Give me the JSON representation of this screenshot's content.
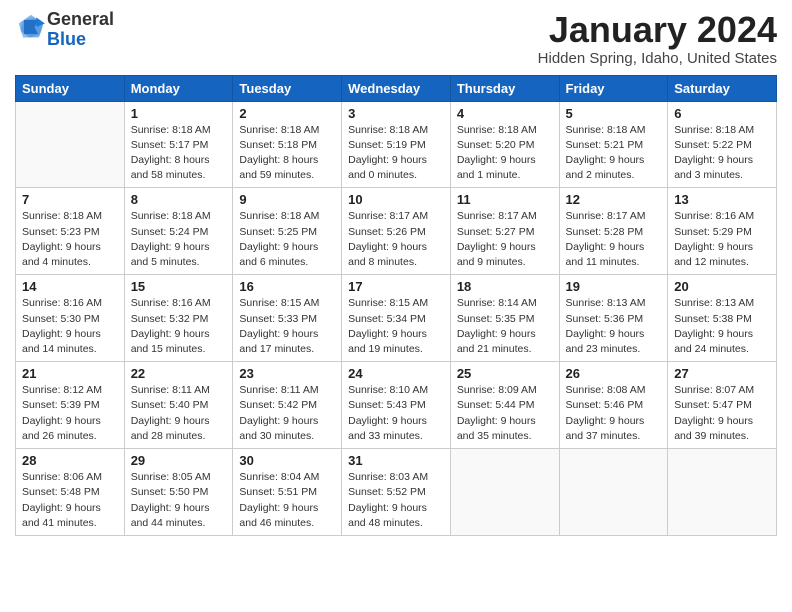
{
  "header": {
    "logo": {
      "general": "General",
      "blue": "Blue"
    },
    "title": "January 2024",
    "location": "Hidden Spring, Idaho, United States"
  },
  "days_of_week": [
    "Sunday",
    "Monday",
    "Tuesday",
    "Wednesday",
    "Thursday",
    "Friday",
    "Saturday"
  ],
  "weeks": [
    [
      {
        "day": "",
        "sunrise": "",
        "sunset": "",
        "daylight": ""
      },
      {
        "day": "1",
        "sunrise": "8:18 AM",
        "sunset": "5:17 PM",
        "daylight": "8 hours and 58 minutes."
      },
      {
        "day": "2",
        "sunrise": "8:18 AM",
        "sunset": "5:18 PM",
        "daylight": "8 hours and 59 minutes."
      },
      {
        "day": "3",
        "sunrise": "8:18 AM",
        "sunset": "5:19 PM",
        "daylight": "9 hours and 0 minutes."
      },
      {
        "day": "4",
        "sunrise": "8:18 AM",
        "sunset": "5:20 PM",
        "daylight": "9 hours and 1 minute."
      },
      {
        "day": "5",
        "sunrise": "8:18 AM",
        "sunset": "5:21 PM",
        "daylight": "9 hours and 2 minutes."
      },
      {
        "day": "6",
        "sunrise": "8:18 AM",
        "sunset": "5:22 PM",
        "daylight": "9 hours and 3 minutes."
      }
    ],
    [
      {
        "day": "7",
        "sunrise": "8:18 AM",
        "sunset": "5:23 PM",
        "daylight": "9 hours and 4 minutes."
      },
      {
        "day": "8",
        "sunrise": "8:18 AM",
        "sunset": "5:24 PM",
        "daylight": "9 hours and 5 minutes."
      },
      {
        "day": "9",
        "sunrise": "8:18 AM",
        "sunset": "5:25 PM",
        "daylight": "9 hours and 6 minutes."
      },
      {
        "day": "10",
        "sunrise": "8:17 AM",
        "sunset": "5:26 PM",
        "daylight": "9 hours and 8 minutes."
      },
      {
        "day": "11",
        "sunrise": "8:17 AM",
        "sunset": "5:27 PM",
        "daylight": "9 hours and 9 minutes."
      },
      {
        "day": "12",
        "sunrise": "8:17 AM",
        "sunset": "5:28 PM",
        "daylight": "9 hours and 11 minutes."
      },
      {
        "day": "13",
        "sunrise": "8:16 AM",
        "sunset": "5:29 PM",
        "daylight": "9 hours and 12 minutes."
      }
    ],
    [
      {
        "day": "14",
        "sunrise": "8:16 AM",
        "sunset": "5:30 PM",
        "daylight": "9 hours and 14 minutes."
      },
      {
        "day": "15",
        "sunrise": "8:16 AM",
        "sunset": "5:32 PM",
        "daylight": "9 hours and 15 minutes."
      },
      {
        "day": "16",
        "sunrise": "8:15 AM",
        "sunset": "5:33 PM",
        "daylight": "9 hours and 17 minutes."
      },
      {
        "day": "17",
        "sunrise": "8:15 AM",
        "sunset": "5:34 PM",
        "daylight": "9 hours and 19 minutes."
      },
      {
        "day": "18",
        "sunrise": "8:14 AM",
        "sunset": "5:35 PM",
        "daylight": "9 hours and 21 minutes."
      },
      {
        "day": "19",
        "sunrise": "8:13 AM",
        "sunset": "5:36 PM",
        "daylight": "9 hours and 23 minutes."
      },
      {
        "day": "20",
        "sunrise": "8:13 AM",
        "sunset": "5:38 PM",
        "daylight": "9 hours and 24 minutes."
      }
    ],
    [
      {
        "day": "21",
        "sunrise": "8:12 AM",
        "sunset": "5:39 PM",
        "daylight": "9 hours and 26 minutes."
      },
      {
        "day": "22",
        "sunrise": "8:11 AM",
        "sunset": "5:40 PM",
        "daylight": "9 hours and 28 minutes."
      },
      {
        "day": "23",
        "sunrise": "8:11 AM",
        "sunset": "5:42 PM",
        "daylight": "9 hours and 30 minutes."
      },
      {
        "day": "24",
        "sunrise": "8:10 AM",
        "sunset": "5:43 PM",
        "daylight": "9 hours and 33 minutes."
      },
      {
        "day": "25",
        "sunrise": "8:09 AM",
        "sunset": "5:44 PM",
        "daylight": "9 hours and 35 minutes."
      },
      {
        "day": "26",
        "sunrise": "8:08 AM",
        "sunset": "5:46 PM",
        "daylight": "9 hours and 37 minutes."
      },
      {
        "day": "27",
        "sunrise": "8:07 AM",
        "sunset": "5:47 PM",
        "daylight": "9 hours and 39 minutes."
      }
    ],
    [
      {
        "day": "28",
        "sunrise": "8:06 AM",
        "sunset": "5:48 PM",
        "daylight": "9 hours and 41 minutes."
      },
      {
        "day": "29",
        "sunrise": "8:05 AM",
        "sunset": "5:50 PM",
        "daylight": "9 hours and 44 minutes."
      },
      {
        "day": "30",
        "sunrise": "8:04 AM",
        "sunset": "5:51 PM",
        "daylight": "9 hours and 46 minutes."
      },
      {
        "day": "31",
        "sunrise": "8:03 AM",
        "sunset": "5:52 PM",
        "daylight": "9 hours and 48 minutes."
      },
      {
        "day": "",
        "sunrise": "",
        "sunset": "",
        "daylight": ""
      },
      {
        "day": "",
        "sunrise": "",
        "sunset": "",
        "daylight": ""
      },
      {
        "day": "",
        "sunrise": "",
        "sunset": "",
        "daylight": ""
      }
    ]
  ],
  "labels": {
    "sunrise": "Sunrise:",
    "sunset": "Sunset:",
    "daylight": "Daylight:"
  }
}
